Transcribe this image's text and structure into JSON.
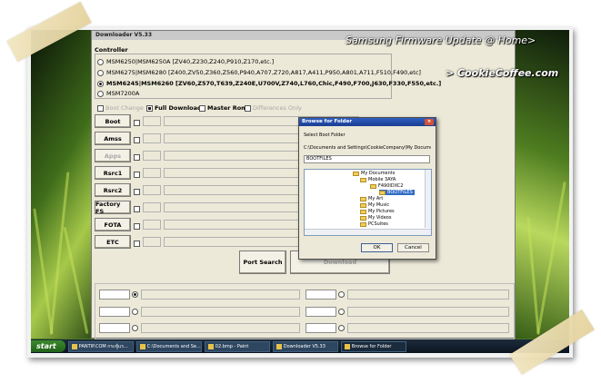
{
  "overlay": {
    "heading": "Samsung Firmware Update @ Home>",
    "subheading": "> CookieCoffee.com"
  },
  "window": {
    "title": "Downloader V5.33",
    "controller_label": "Controller",
    "models": [
      {
        "label": "MSM6250|MSM6250A [ZV40,Z230,Z240,P910,Z170,etc.]",
        "selected": false
      },
      {
        "label": "MSM6275|MSM6280 [Z400,ZV50,Z360,Z560,P940,A707,Z720,A817,A411,P950,A801,A711,F510,F490,etc]",
        "selected": false
      },
      {
        "label": "MSM6245|MSM6260 [ZV60,Z570,T639,Z240E,U700V,Z740,L760,Chic,F490,F700,J630,F330,F550,etc.]",
        "selected": true
      },
      {
        "label": "MSM7200A",
        "selected": false
      }
    ],
    "options": [
      {
        "label": "Boot Change",
        "checked": false,
        "enabled": false
      },
      {
        "label": "Full Download",
        "checked": true,
        "enabled": true
      },
      {
        "label": "Master Rom",
        "checked": false,
        "enabled": true
      },
      {
        "label": "Differences Only",
        "checked": false,
        "enabled": false
      }
    ],
    "file_buttons": [
      {
        "label": "Boot",
        "enabled": true
      },
      {
        "label": "Amss",
        "enabled": true
      },
      {
        "label": "Apps",
        "enabled": false
      },
      {
        "label": "Rsrc1",
        "enabled": true
      },
      {
        "label": "Rsrc2",
        "enabled": true
      },
      {
        "label": "Factory FS",
        "enabled": true
      },
      {
        "label": "FOTA",
        "enabled": true
      },
      {
        "label": "ETC",
        "enabled": true
      }
    ],
    "port_search_label": "Port Search",
    "download_label": "Download"
  },
  "dialog": {
    "title": "Browse for Folder",
    "close": "×",
    "instruction": "Select Boot Folder",
    "path": "C:\\Documents and Settings\\CookieCompany\\My Documents\\F",
    "folder_value": "BOOTFILES",
    "tree_items": [
      {
        "label": "My Documents"
      },
      {
        "label": "Mobile 3AYA"
      },
      {
        "label": "F490IDXC2"
      },
      {
        "label": "BOOTFILES",
        "selected": true
      },
      {
        "label": "My Art"
      },
      {
        "label": "My Music"
      },
      {
        "label": "My Pictures"
      },
      {
        "label": "My Videos"
      },
      {
        "label": "PCSuites"
      }
    ],
    "ok_label": "OK",
    "cancel_label": "Cancel"
  },
  "taskbar": {
    "start_label": "start",
    "items": [
      {
        "label": "PANTIP.COM กระทู้แร...",
        "active": false
      },
      {
        "label": "C:\\Documents and Se...",
        "active": false
      },
      {
        "label": "02.bmp - Paint",
        "active": false
      },
      {
        "label": "Downloader V5.33",
        "active": false
      },
      {
        "label": "Browse for Folder",
        "active": true
      }
    ]
  }
}
